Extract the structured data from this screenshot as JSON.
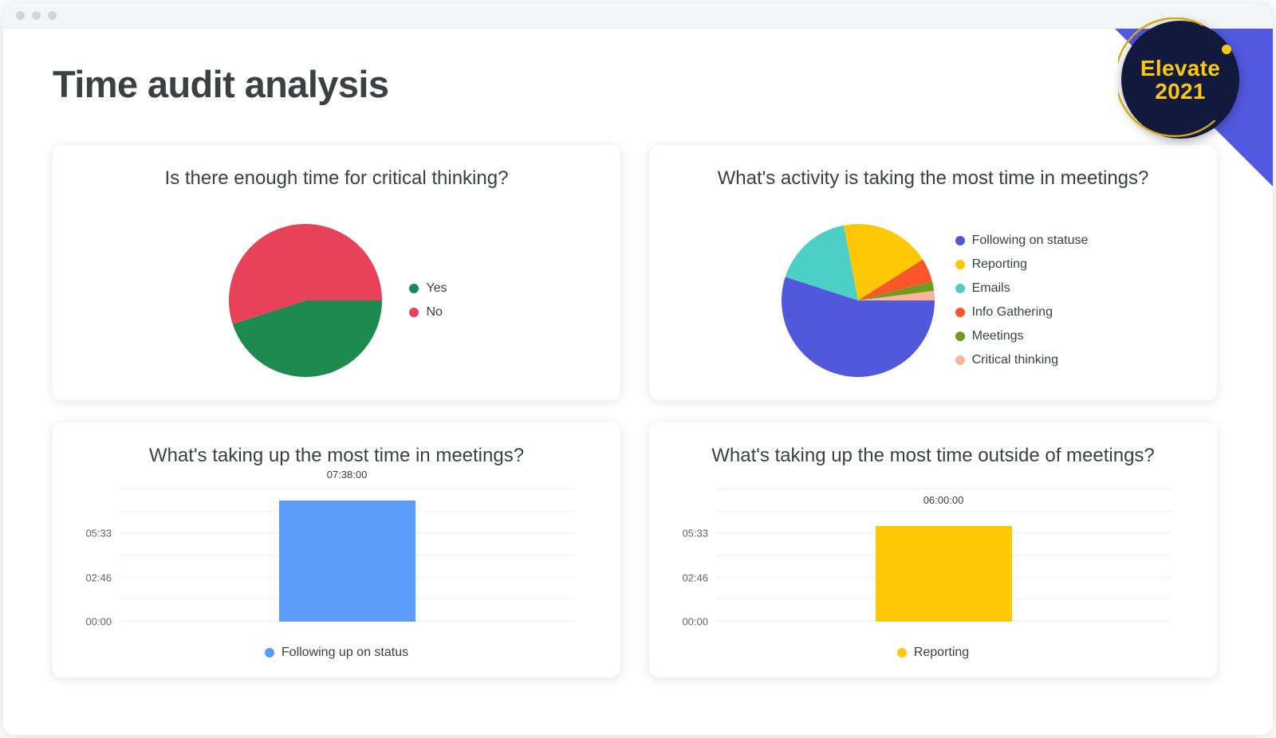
{
  "window": {
    "traffic_lights": [
      "close-dot",
      "minimize-dot",
      "maximize-dot"
    ],
    "titlebar_color": "#f4f5f7"
  },
  "decor": {
    "corner_wedge_color": "#5358e0",
    "badge": {
      "line1": "Elevate",
      "line2": "2021",
      "circle_color": "#111a3d",
      "text_color": "#ffc806",
      "ring_color": "#d3a812"
    }
  },
  "header": {
    "title": "Time audit analysis",
    "title_color": "#3c4043"
  },
  "cards": [
    {
      "id": "pie-critical-thinking",
      "title": "Is there enough time for critical thinking?"
    },
    {
      "id": "pie-meeting-activity",
      "title": "What's activity is taking the most time in meetings?"
    },
    {
      "id": "bar-in-meetings",
      "title": "What's taking up the most time in meetings?"
    },
    {
      "id": "bar-outside-meetings",
      "title": "What's taking up the most time outside of meetings?"
    }
  ],
  "chart_data": [
    {
      "id": "pie-critical-thinking",
      "type": "pie",
      "title": "Is there enough time for critical thinking?",
      "legend_position": "right",
      "start_angle_deg": 0,
      "direction": "clockwise",
      "categories": [
        "Yes",
        "No"
      ],
      "values": [
        45,
        55
      ],
      "colors": [
        "#1e8a4f",
        "#e8415a"
      ],
      "slices": [
        {
          "label": "Yes",
          "value": 45,
          "color": "#1e8a4f"
        },
        {
          "label": "No",
          "value": 55,
          "color": "#e8415a"
        }
      ]
    },
    {
      "id": "pie-meeting-activity",
      "type": "pie",
      "title": "What's activity is taking the most time in meetings?",
      "legend_position": "right",
      "start_angle_deg": 0,
      "direction": "clockwise",
      "categories": [
        "Following on statuse",
        "Reporting",
        "Emails",
        "Info Gathering",
        "Meetings",
        "Critical thinking"
      ],
      "values": [
        55,
        19,
        17,
        5,
        2,
        2
      ],
      "colors": [
        "#5258dc",
        "#ffc806",
        "#4ccfc4",
        "#f9562a",
        "#6d9c21",
        "#f9b49c"
      ],
      "slices": [
        {
          "label": "Following on statuse",
          "value": 55,
          "color": "#5258dc"
        },
        {
          "label": "Emails",
          "value": 17,
          "color": "#4ccfc4"
        },
        {
          "label": "Reporting",
          "value": 19,
          "color": "#ffc806"
        },
        {
          "label": "Info Gathering",
          "value": 5,
          "color": "#f9562a"
        },
        {
          "label": "Meetings",
          "value": 2,
          "color": "#6d9c21"
        },
        {
          "label": "Critical thinking",
          "value": 2,
          "color": "#f9b49c"
        }
      ],
      "legend_order": [
        "Following on statuse",
        "Reporting",
        "Emails",
        "Info Gathering",
        "Meetings",
        "Critical thinking"
      ]
    },
    {
      "id": "bar-in-meetings",
      "type": "bar",
      "title": "What's taking up the most time in meetings?",
      "categories": [
        "Following up on status"
      ],
      "values": [
        "07:38:00"
      ],
      "value_seconds": [
        27480
      ],
      "bar_color": "#5b9cf8",
      "legend": [
        {
          "label": "Following up on status",
          "color": "#5b9cf8"
        }
      ],
      "legend_position": "bottom",
      "ylabel": "",
      "xlabel": "",
      "ytick_labels": [
        "00:00",
        "",
        "02:46",
        "",
        "05:33",
        "",
        ""
      ],
      "ytick_seconds": [
        0,
        5000,
        9960,
        14960,
        19980,
        24980,
        30000
      ],
      "ylim_seconds": [
        0,
        30000
      ],
      "grid": true
    },
    {
      "id": "bar-outside-meetings",
      "type": "bar",
      "title": "What's taking up the most time outside of meetings?",
      "categories": [
        "Reporting"
      ],
      "values": [
        "06:00:00"
      ],
      "value_seconds": [
        21600
      ],
      "bar_color": "#ffc806",
      "legend": [
        {
          "label": "Reporting",
          "color": "#ffc806"
        }
      ],
      "legend_position": "bottom",
      "ylabel": "",
      "xlabel": "",
      "ytick_labels": [
        "00:00",
        "",
        "02:46",
        "",
        "05:33",
        "",
        ""
      ],
      "ytick_seconds": [
        0,
        5000,
        9960,
        14960,
        19980,
        24980,
        30000
      ],
      "ylim_seconds": [
        0,
        30000
      ],
      "grid": true
    }
  ]
}
